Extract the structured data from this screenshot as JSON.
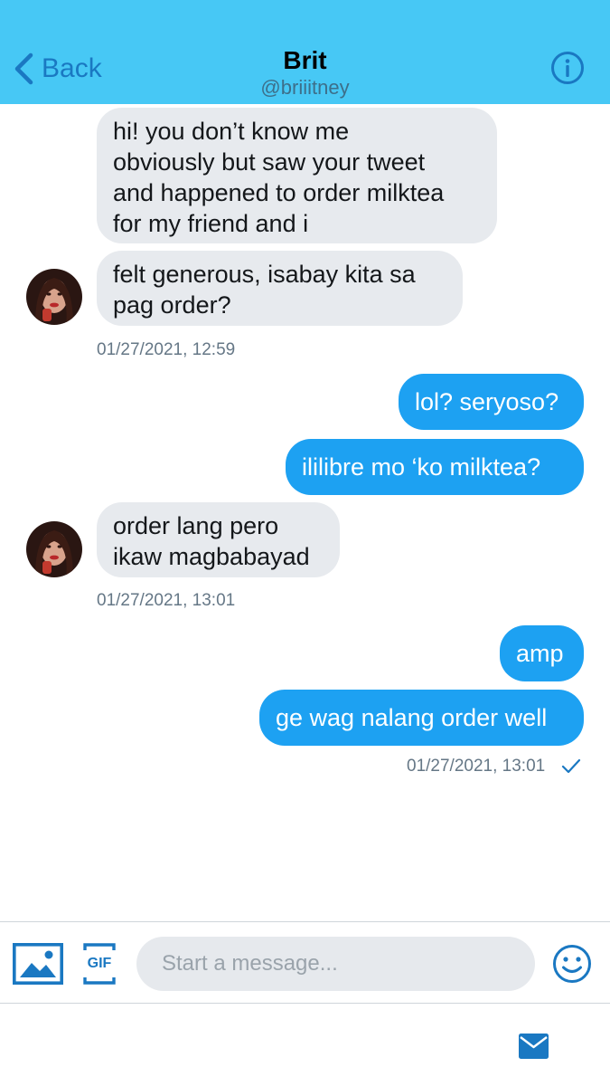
{
  "header": {
    "back_label": "Back",
    "name": "Brit",
    "handle": "@briiitney"
  },
  "messages": [
    {
      "direction": "in",
      "text": "hi! you don’t know me\nobviously but saw your tweet\nand happened to order milktea\nfor my friend and i"
    },
    {
      "direction": "in",
      "text": "felt generous, isabay kita sa\npag order?"
    },
    {
      "direction": "out",
      "text": "lol? seryoso?"
    },
    {
      "direction": "out",
      "text": "ililibre mo ‘ko milktea?"
    },
    {
      "direction": "in",
      "text": "order lang pero\nikaw magbabayad"
    },
    {
      "direction": "out",
      "text": "amp"
    },
    {
      "direction": "out",
      "text": "ge wag nalang order well"
    }
  ],
  "timestamps": [
    "01/27/2021, 12:59",
    "01/27/2021, 13:01",
    "01/27/2021, 13:01"
  ],
  "composer": {
    "placeholder": "Start a message...",
    "gif_label": "GIF"
  },
  "colors": {
    "header_bg": "#47c8f5",
    "accent": "#1da1f2",
    "incoming_bubble": "#e7eaee",
    "icon_blue": "#1a78c2"
  },
  "icons": [
    "chevron-left-icon",
    "info-icon",
    "image-icon",
    "gif-icon",
    "emoji-icon",
    "envelope-icon",
    "checkmark-icon"
  ]
}
